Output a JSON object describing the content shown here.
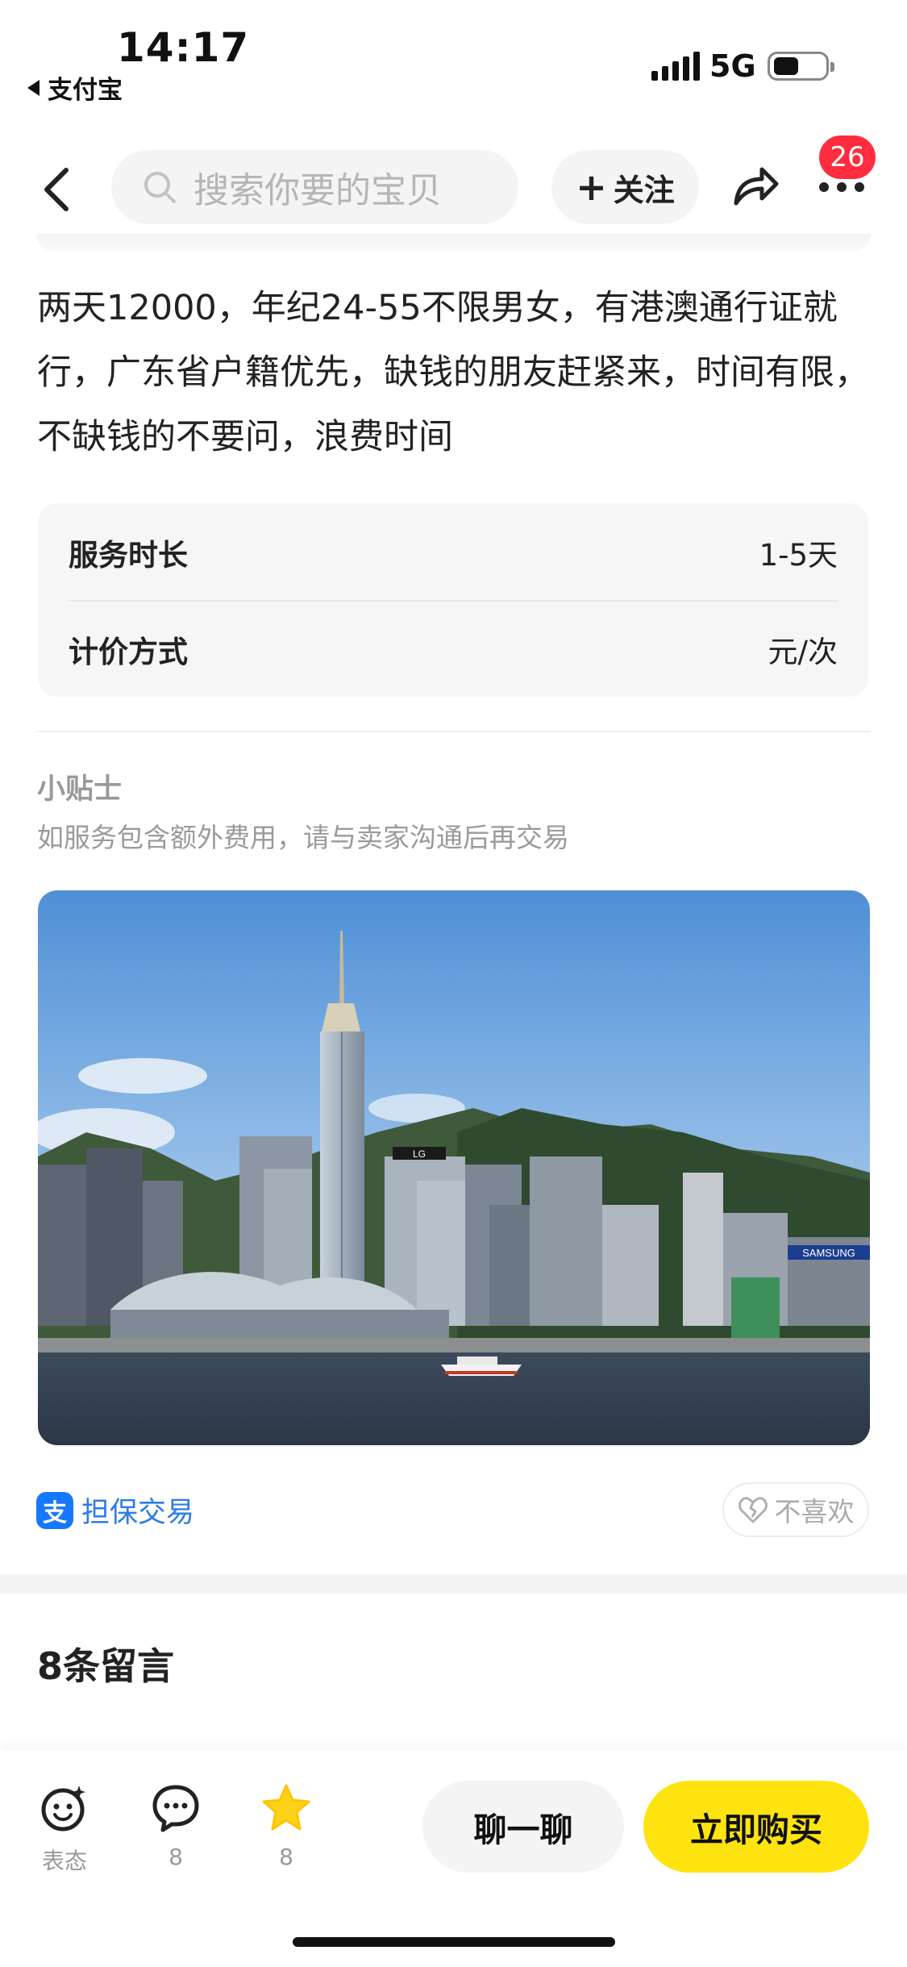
{
  "status_bar": {
    "time": "14:17",
    "back_app": "支付宝",
    "network": "5G"
  },
  "nav": {
    "search_placeholder": "搜索你要的宝贝",
    "follow_label": "关注",
    "badge_count": "26"
  },
  "description": "两天12000，年纪24-55不限男女，有港澳通行证就行，广东省户籍优先，缺钱的朋友赶紧来，时间有限，不缺钱的不要问，浪费时间",
  "info": {
    "rows": [
      {
        "key": "服务时长",
        "value": "1-5天"
      },
      {
        "key": "计价方式",
        "value": "元/次"
      }
    ]
  },
  "tips": {
    "title": "小贴士",
    "text": "如服务包含额外费用，请与卖家沟通后再交易"
  },
  "photo_logos": {
    "lg": "LG",
    "samsung": "SAMSUNG"
  },
  "guarantee": {
    "logo_char": "支",
    "label": "担保交易"
  },
  "dislike_label": "不喜欢",
  "comments": {
    "title": "8条留言"
  },
  "bottom_bar": {
    "react_label": "表态",
    "comment_count": "8",
    "favorite_count": "8",
    "chat_label": "聊一聊",
    "buy_label": "立即购买"
  },
  "colors": {
    "accent_yellow": "#ffe30f",
    "badge_red": "#ff2d3f",
    "link_blue": "#2b7ce6",
    "alipay_blue": "#1677ff"
  }
}
